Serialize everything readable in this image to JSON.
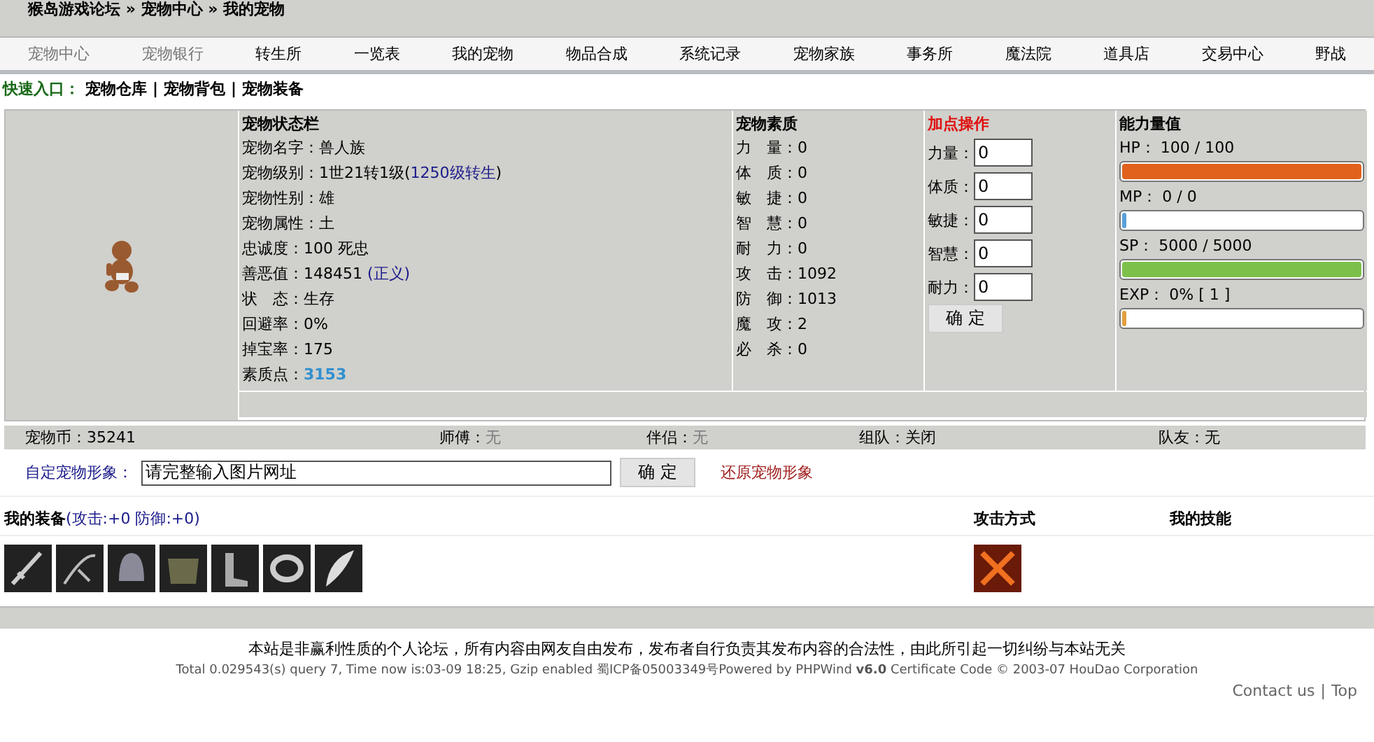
{
  "breadcrumb": "猴岛游戏论坛 » 宠物中心 » 我的宠物",
  "nav": [
    "宠物中心",
    "宠物银行",
    "转生所",
    "一览表",
    "我的宠物",
    "物品合成",
    "系统记录",
    "宠物家族",
    "事务所",
    "魔法院",
    "道具店",
    "交易中心",
    "野战"
  ],
  "quick_links": {
    "label": "快速入口：",
    "separator": "|",
    "links": [
      "宠物仓库",
      "宠物背包",
      "宠物装备"
    ]
  },
  "status": {
    "title": "宠物状态栏",
    "rows": [
      {
        "label": "宠物名字：",
        "segments": [
          {
            "text": "兽人族",
            "kind": "plain"
          }
        ]
      },
      {
        "label": "宠物级别：",
        "segments": [
          {
            "text": "1世21转1级(",
            "kind": "plain"
          },
          {
            "text": "1250级转生",
            "kind": "link"
          },
          {
            "text": ")",
            "kind": "plain"
          }
        ]
      },
      {
        "label": "宠物性别：",
        "segments": [
          {
            "text": "雄",
            "kind": "plain"
          }
        ]
      },
      {
        "label": "宠物属性：",
        "segments": [
          {
            "text": "土",
            "kind": "plain"
          }
        ]
      },
      {
        "label": "忠诚度：",
        "segments": [
          {
            "text": "100 死忠",
            "kind": "plain"
          }
        ]
      },
      {
        "label": "善恶值：",
        "segments": [
          {
            "text": "148451 ",
            "kind": "plain"
          },
          {
            "text": "(正义)",
            "kind": "link"
          }
        ]
      },
      {
        "label": "状　态：",
        "segments": [
          {
            "text": "生存",
            "kind": "plain"
          }
        ]
      },
      {
        "label": "回避率：",
        "segments": [
          {
            "text": "0%",
            "kind": "plain"
          }
        ]
      },
      {
        "label": "掉宝率：",
        "segments": [
          {
            "text": "175",
            "kind": "plain"
          }
        ]
      },
      {
        "label": "素质点：",
        "segments": [
          {
            "text": "3153",
            "kind": "highlight"
          }
        ]
      }
    ]
  },
  "quality": {
    "title": "宠物素质",
    "rows": [
      {
        "label": "力　量：",
        "value": "0"
      },
      {
        "label": "体　质：",
        "value": "0"
      },
      {
        "label": "敏　捷：",
        "value": "0"
      },
      {
        "label": "智　慧：",
        "value": "0"
      },
      {
        "label": "耐　力：",
        "value": "0"
      },
      {
        "label": "攻　击：",
        "value": "1092"
      },
      {
        "label": "防　御：",
        "value": "1013"
      },
      {
        "label": "魔　攻：",
        "value": "2"
      },
      {
        "label": "必　杀：",
        "value": "0"
      }
    ]
  },
  "add_points": {
    "title": "加点操作",
    "fields": [
      {
        "label": "力量：",
        "value": "0"
      },
      {
        "label": "体质：",
        "value": "0"
      },
      {
        "label": "敏捷：",
        "value": "0"
      },
      {
        "label": "智慧：",
        "value": "0"
      },
      {
        "label": "耐力：",
        "value": "0"
      }
    ],
    "button": "确 定"
  },
  "ability": {
    "title": "能力量值",
    "bars": [
      {
        "label": "HP： 100 / 100",
        "level": 1,
        "color": "#e0621c"
      },
      {
        "label": "MP： 0 / 0",
        "level": 0,
        "color": "#5aa0d8"
      },
      {
        "label": "SP： 5000 / 5000",
        "level": 1,
        "color": "#7cc04a"
      },
      {
        "label": "EXP： 0% [ 1 ]",
        "level": 0,
        "color": "#e0a040"
      }
    ]
  },
  "stats": [
    {
      "label": "宠物币：",
      "value": "35241",
      "muted": false
    },
    {
      "label": "师傅：",
      "value": "无",
      "muted": true
    },
    {
      "label": "伴侣：",
      "value": "无",
      "muted": true
    },
    {
      "label": "组队：",
      "value": "关闭",
      "muted": false
    },
    {
      "label": "队友：",
      "value": "无",
      "muted": false
    }
  ],
  "custom_image": {
    "label": "自定宠物形象：",
    "value": "请完整输入图片网址",
    "button": "确 定",
    "link": "还原宠物形象"
  },
  "equipment": {
    "title": "我的装备",
    "bonus": "(攻击:+0 防御:+0)",
    "attack_title": "攻击方式",
    "skills_title": "我的技能"
  },
  "footer": {
    "disclaimer": "本站是非赢利性质的个人论坛，所有内容由网友自由发布，发布者自行负责其发布内容的合法性，由此所引起一切纠纷与本站无关",
    "info": "Total 0.029543(s) query 7, Time now is:03-09 18:25, Gzip enabled 蜀ICP备05003349号Powered by PHPWind **v6.0** Certificate Code © 2003-07 HouDao Corporation",
    "links": [
      "Contact us",
      "Top"
    ],
    "separator": "|"
  }
}
